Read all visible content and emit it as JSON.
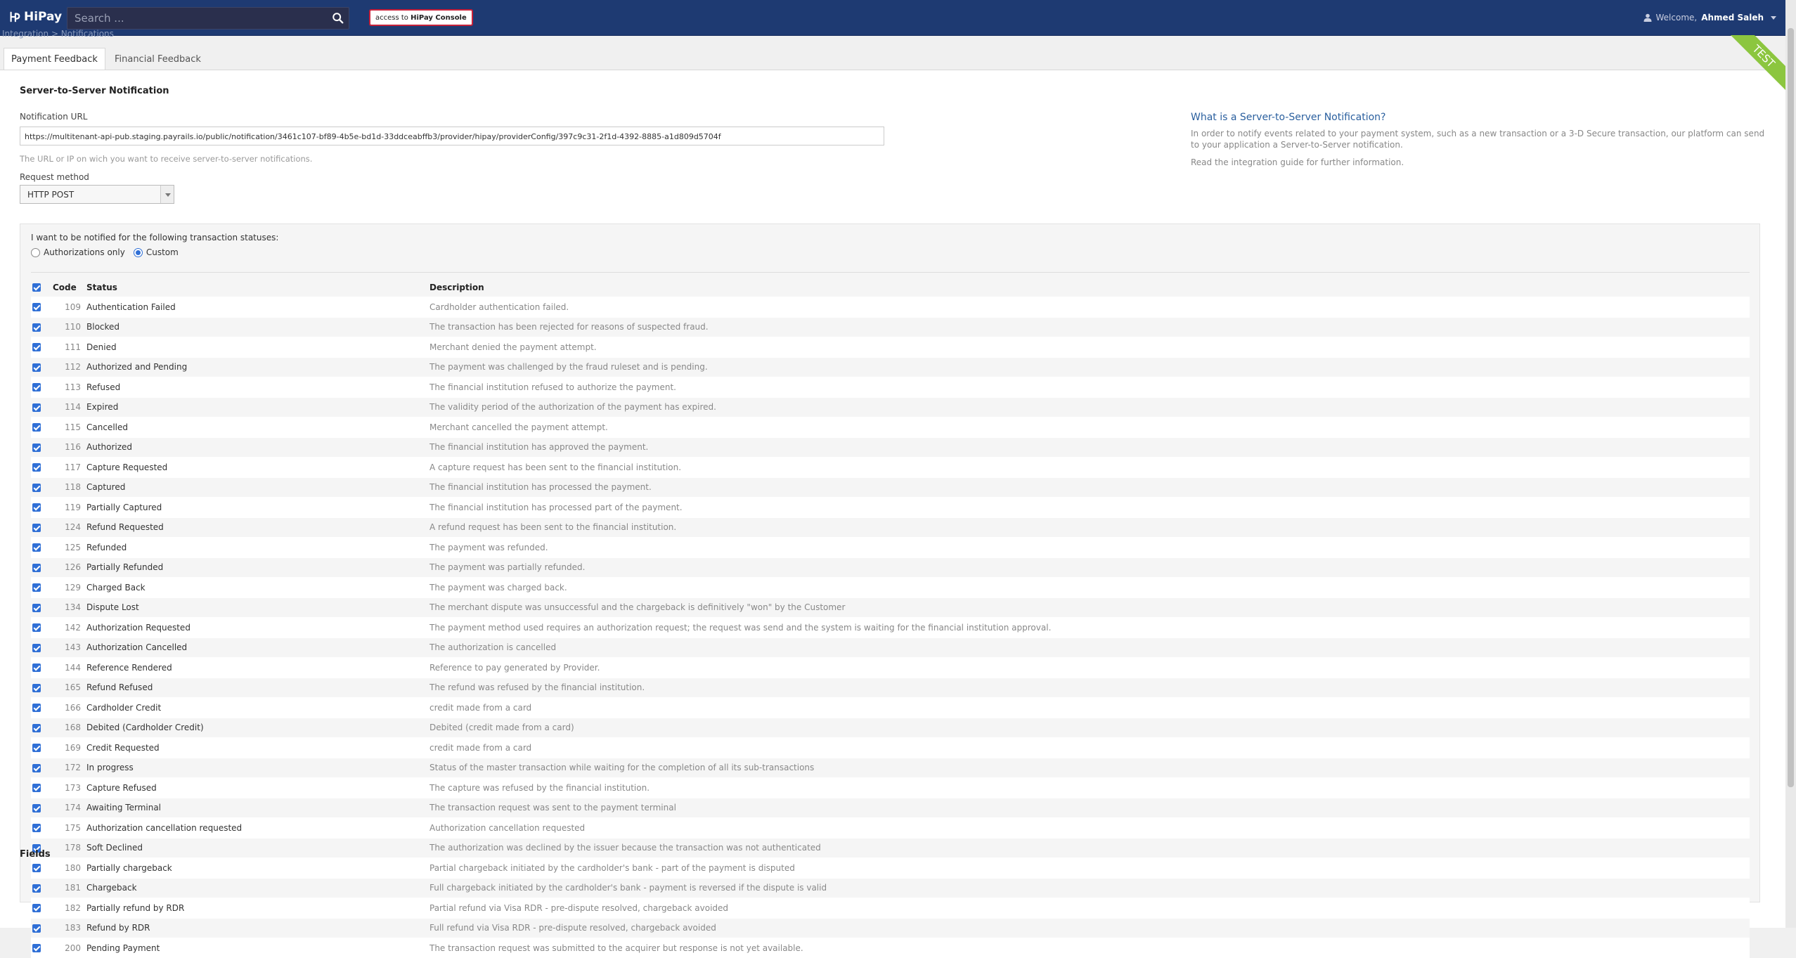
{
  "header": {
    "logo": "HiPay",
    "search_placeholder": "Search ...",
    "console_prefix": "access to",
    "console_label": "HiPay Console",
    "welcome_prefix": "Welcome,",
    "user_name": "Ahmed Saleh"
  },
  "breadcrumb": "Integration  >  Notifications",
  "tabs": [
    "Payment Feedback",
    "Financial Feedback"
  ],
  "ribbon": "TEST",
  "section": {
    "title": "Server-to-Server Notification",
    "url_label": "Notification URL",
    "url_value": "https://multitenant-api-pub.staging.payrails.io/public/notification/3461c107-bf89-4b5e-bd1d-33ddceabffb3/provider/hipay/providerConfig/397c9c31-2f1d-4392-8885-a1d809d5704f",
    "url_hint": "The URL or IP on wich you want to receive server-to-server notifications.",
    "method_label": "Request method",
    "method_value": "HTTP POST"
  },
  "help": {
    "title": "What is a Server-to-Server Notification?",
    "text": "In order to notify events related to your payment system, such as a new transaction or a 3-D Secure transaction, our platform can send to your application a Server-to-Server notification.",
    "text2": "Read the integration guide for further information."
  },
  "statuses": {
    "intro": "I want to be notified for the following transaction statuses:",
    "option_auth": "Authorizations only",
    "option_custom": "Custom",
    "col_code": "Code",
    "col_status": "Status",
    "col_desc": "Description",
    "rows": [
      {
        "code": "109",
        "status": "Authentication Failed",
        "desc": "Cardholder authentication failed."
      },
      {
        "code": "110",
        "status": "Blocked",
        "desc": "The transaction has been rejected for reasons of suspected fraud."
      },
      {
        "code": "111",
        "status": "Denied",
        "desc": "Merchant denied the payment attempt."
      },
      {
        "code": "112",
        "status": "Authorized and Pending",
        "desc": "The payment was challenged by the fraud ruleset and is pending."
      },
      {
        "code": "113",
        "status": "Refused",
        "desc": "The financial institution refused to authorize the payment."
      },
      {
        "code": "114",
        "status": "Expired",
        "desc": "The validity period of the authorization of the payment has expired."
      },
      {
        "code": "115",
        "status": "Cancelled",
        "desc": "Merchant cancelled the payment attempt."
      },
      {
        "code": "116",
        "status": "Authorized",
        "desc": "The financial institution has approved the payment."
      },
      {
        "code": "117",
        "status": "Capture Requested",
        "desc": "A capture request has been sent to the financial institution."
      },
      {
        "code": "118",
        "status": "Captured",
        "desc": "The financial institution has processed the payment."
      },
      {
        "code": "119",
        "status": "Partially Captured",
        "desc": "The financial institution has processed part of the payment."
      },
      {
        "code": "124",
        "status": "Refund Requested",
        "desc": "A refund request has been sent to the financial institution."
      },
      {
        "code": "125",
        "status": "Refunded",
        "desc": "The payment was refunded."
      },
      {
        "code": "126",
        "status": "Partially Refunded",
        "desc": "The payment was partially refunded."
      },
      {
        "code": "129",
        "status": "Charged Back",
        "desc": "The payment was charged back."
      },
      {
        "code": "134",
        "status": "Dispute Lost",
        "desc": "The merchant dispute was unsuccessful and the chargeback is definitively \"won\" by the Customer"
      },
      {
        "code": "142",
        "status": "Authorization Requested",
        "desc": "The payment method used requires an authorization request; the request was send and the system is waiting for the financial institution approval."
      },
      {
        "code": "143",
        "status": "Authorization Cancelled",
        "desc": "The authorization is cancelled"
      },
      {
        "code": "144",
        "status": "Reference Rendered",
        "desc": "Reference to pay generated by Provider."
      },
      {
        "code": "165",
        "status": "Refund Refused",
        "desc": "The refund was refused by the financial institution."
      },
      {
        "code": "166",
        "status": "Cardholder Credit",
        "desc": "credit made from a card"
      },
      {
        "code": "168",
        "status": "Debited (Cardholder Credit)",
        "desc": "Debited (credit made from a card)"
      },
      {
        "code": "169",
        "status": "Credit Requested",
        "desc": "credit made from a card"
      },
      {
        "code": "172",
        "status": "In progress",
        "desc": "Status of the master transaction while waiting for the completion of all its sub-transactions"
      },
      {
        "code": "173",
        "status": "Capture Refused",
        "desc": "The capture was refused by the financial institution."
      },
      {
        "code": "174",
        "status": "Awaiting Terminal",
        "desc": "The transaction request was sent to the payment terminal"
      },
      {
        "code": "175",
        "status": "Authorization cancellation requested",
        "desc": "Authorization cancellation requested"
      },
      {
        "code": "178",
        "status": "Soft Declined",
        "desc": "The authorization was declined by the issuer because the transaction was not authenticated"
      },
      {
        "code": "180",
        "status": "Partially chargeback",
        "desc": "Partial chargeback initiated by the cardholder's bank - part of the payment is disputed"
      },
      {
        "code": "181",
        "status": "Chargeback",
        "desc": "Full chargeback initiated by the cardholder's bank - payment is reversed if the dispute is valid"
      },
      {
        "code": "182",
        "status": "Partially refund by RDR",
        "desc": "Partial refund via Visa RDR - pre-dispute resolved, chargeback avoided"
      },
      {
        "code": "183",
        "status": "Refund by RDR",
        "desc": "Full refund via Visa RDR - pre-dispute resolved, chargeback avoided"
      },
      {
        "code": "200",
        "status": "Pending Payment",
        "desc": "The transaction request was submitted to the acquirer but response is not yet available."
      }
    ]
  },
  "fields_title": "Fields"
}
